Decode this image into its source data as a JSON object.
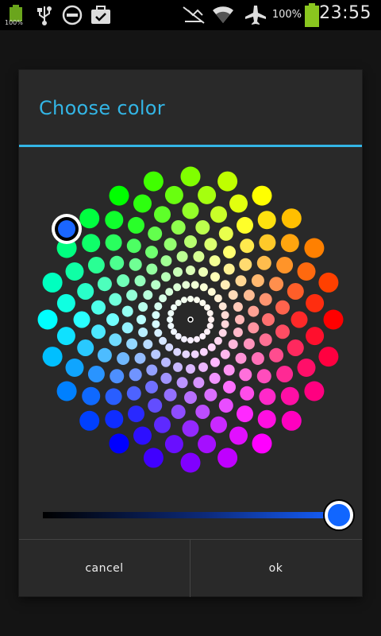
{
  "status_bar": {
    "battery_small_label": "100%",
    "battery_percent": "100%",
    "time": "23:55",
    "icons": [
      "battery-icon",
      "usb-icon",
      "do-not-disturb-icon",
      "briefcase-icon",
      "signal-off-icon",
      "wifi-icon",
      "airplane-mode-icon",
      "battery-full-icon"
    ]
  },
  "dialog": {
    "title": "Choose color",
    "accent_color": "#33b5e5",
    "selected_color": "#1a66ff",
    "brightness_fraction": 1.0,
    "buttons": {
      "cancel": "cancel",
      "ok": "ok"
    }
  }
}
